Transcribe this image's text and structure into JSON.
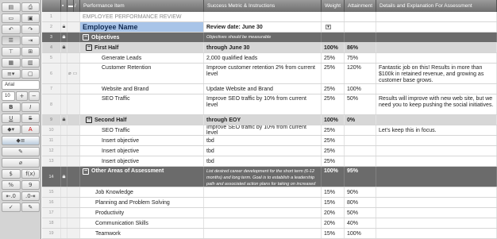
{
  "toolbar": {
    "font_name": "Arial",
    "font_size": "10",
    "icons": [
      "sheet-icon",
      "print-icon",
      "card-view-icon",
      "undo-icon",
      "redo-icon",
      "hierarchy-icon",
      "indent-icon",
      "outdent-icon",
      "filter-icon",
      "lock-column-icon",
      "freeze-icon",
      "wrap-text-icon",
      "format-icon",
      "bold-icon",
      "italic-icon",
      "underline-icon",
      "strikethrough-icon",
      "fill-color-icon",
      "text-color-icon",
      "align-icon",
      "highlight-icon",
      "clear-format-icon",
      "currency-icon",
      "formula-icon",
      "percent-icon",
      "comma-icon",
      "decimal-icon",
      "more-decimal-icon",
      "link-icon",
      "pen-icon"
    ],
    "glyphs": {
      "undo": "↶",
      "redo": "↷",
      "bold": "B",
      "italic": "I",
      "underline": "U",
      "strike": "S",
      "plus": "+",
      "minus": "−",
      "text_color": "A",
      "currency": "$",
      "formula": "f(x)",
      "percent": "%",
      "comma": "9",
      "decimals": ".00"
    }
  },
  "columns": {
    "item": "Performance Item",
    "metric": "Success Metric & Instructions",
    "weight": "Weight",
    "attainment": "Attainment",
    "details": "Details and Explanation For Assessment"
  },
  "rows": [
    {
      "num": "1",
      "item": "EMPLOYEE PERFORMANCE REVIEW",
      "metric": "",
      "weight": "",
      "attainment": "",
      "details": ""
    },
    {
      "num": "2",
      "item": "Employee Name",
      "metric": "Review date: June 30",
      "weight": "",
      "attainment": "",
      "details": ""
    },
    {
      "num": "3",
      "item": "Objectives",
      "metric": "Objectives should be measurable",
      "weight": "",
      "attainment": "",
      "details": ""
    },
    {
      "num": "4",
      "item": "First Half",
      "metric": "through June 30",
      "weight": "100%",
      "attainment": "86%",
      "details": ""
    },
    {
      "num": "5",
      "item": "Generate Leads",
      "metric": "2,000 qualified leads",
      "weight": "25%",
      "attainment": "75%",
      "details": ""
    },
    {
      "num": "6",
      "item": "Customer Retention",
      "metric": "Improve customer retention 2% from current level",
      "weight": "25%",
      "attainment": "120%",
      "details": "Fantastic job on this! Results in more than $100k in retained revenue, and growing as customer base grows."
    },
    {
      "num": "7",
      "item": "Website and Brand",
      "metric": "Update Website and Brand",
      "weight": "25%",
      "attainment": "100%",
      "details": ""
    },
    {
      "num": "8",
      "item": "SEO Traffic",
      "metric": "Improve SEO traffic by 10% from current level",
      "weight": "25%",
      "attainment": "50%",
      "details": "Results will improve with new web site, but we need you to keep pushing the social initiatives."
    },
    {
      "num": "9",
      "item": "Second Half",
      "metric": "through EOY",
      "weight": "100%",
      "attainment": "0%",
      "details": ""
    },
    {
      "num": "10",
      "item": "SEO Traffic",
      "metric": "Improve SEO traffic by 10% from current level",
      "weight": "25%",
      "attainment": "",
      "details": "Let's keep this in focus."
    },
    {
      "num": "11",
      "item": "Insert objective",
      "metric": "tbd",
      "weight": "25%",
      "attainment": "",
      "details": ""
    },
    {
      "num": "12",
      "item": "Insert objective",
      "metric": "tbd",
      "weight": "25%",
      "attainment": "",
      "details": ""
    },
    {
      "num": "13",
      "item": "Insert objective",
      "metric": "tbd",
      "weight": "25%",
      "attainment": "",
      "details": ""
    },
    {
      "num": "14",
      "item": "Other Areas of Assessment",
      "metric": "List desired career development for the short term (6-12 months) and long term. Goal is to establish a leadership path and associated action plans for taking on increased responsibilities and opportunities.",
      "weight": "100%",
      "attainment": "95%",
      "details": ""
    },
    {
      "num": "15",
      "item": "Job Knowledge",
      "metric": "",
      "weight": "15%",
      "attainment": "90%",
      "details": ""
    },
    {
      "num": "16",
      "item": "Planning and Problem Solving",
      "metric": "",
      "weight": "15%",
      "attainment": "80%",
      "details": ""
    },
    {
      "num": "17",
      "item": "Productivity",
      "metric": "",
      "weight": "20%",
      "attainment": "50%",
      "details": ""
    },
    {
      "num": "18",
      "item": "Communication Skills",
      "metric": "",
      "weight": "20%",
      "attainment": "40%",
      "details": ""
    },
    {
      "num": "19",
      "item": "Teamwork",
      "metric": "",
      "weight": "15%",
      "attainment": "100%",
      "details": ""
    }
  ],
  "colors": {
    "header": "#7a7a7a",
    "parent_row": "#6b6b6b",
    "sub_row": "#d7d7d7",
    "name_cell": "#a8c4e8",
    "toolbar": "#d4d4d4"
  }
}
